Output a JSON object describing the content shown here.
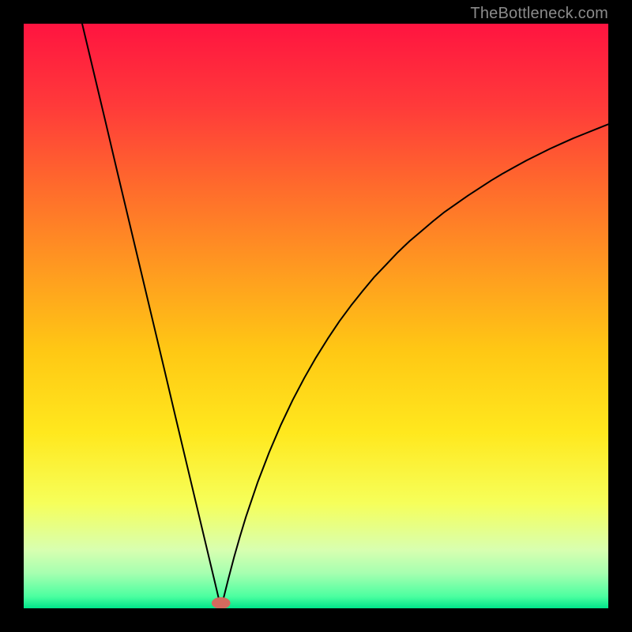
{
  "attribution": "TheBottleneck.com",
  "chart_data": {
    "type": "line",
    "title": "",
    "xlabel": "",
    "ylabel": "",
    "xlim": [
      0,
      100
    ],
    "ylim": [
      0,
      100
    ],
    "background_gradient": {
      "stops": [
        {
          "offset": 0.0,
          "color": "#ff1440"
        },
        {
          "offset": 0.14,
          "color": "#ff3a3a"
        },
        {
          "offset": 0.28,
          "color": "#ff6b2c"
        },
        {
          "offset": 0.42,
          "color": "#ff9a20"
        },
        {
          "offset": 0.56,
          "color": "#ffc814"
        },
        {
          "offset": 0.7,
          "color": "#ffe81e"
        },
        {
          "offset": 0.82,
          "color": "#f6ff5a"
        },
        {
          "offset": 0.9,
          "color": "#d8ffb0"
        },
        {
          "offset": 0.94,
          "color": "#a6ffb0"
        },
        {
          "offset": 0.98,
          "color": "#4bffa0"
        },
        {
          "offset": 1.0,
          "color": "#00e58a"
        }
      ]
    },
    "series": [
      {
        "name": "curve",
        "stroke": "#000000",
        "stroke_width": 2,
        "points": [
          {
            "x": 10.0,
            "y": 100.0
          },
          {
            "x": 12.0,
            "y": 91.6
          },
          {
            "x": 14.0,
            "y": 83.2
          },
          {
            "x": 16.0,
            "y": 74.7
          },
          {
            "x": 18.0,
            "y": 66.3
          },
          {
            "x": 20.0,
            "y": 57.9
          },
          {
            "x": 22.0,
            "y": 49.5
          },
          {
            "x": 24.0,
            "y": 41.1
          },
          {
            "x": 26.0,
            "y": 32.6
          },
          {
            "x": 28.0,
            "y": 24.2
          },
          {
            "x": 30.0,
            "y": 15.8
          },
          {
            "x": 31.0,
            "y": 11.6
          },
          {
            "x": 32.0,
            "y": 7.4
          },
          {
            "x": 32.5,
            "y": 5.3
          },
          {
            "x": 33.0,
            "y": 3.2
          },
          {
            "x": 33.4,
            "y": 1.5
          },
          {
            "x": 33.75,
            "y": 0.0
          },
          {
            "x": 34.1,
            "y": 1.4
          },
          {
            "x": 34.5,
            "y": 3.0
          },
          {
            "x": 35.0,
            "y": 5.0
          },
          {
            "x": 36.0,
            "y": 8.8
          },
          {
            "x": 37.0,
            "y": 12.3
          },
          {
            "x": 38.0,
            "y": 15.6
          },
          {
            "x": 40.0,
            "y": 21.5
          },
          {
            "x": 42.0,
            "y": 26.7
          },
          {
            "x": 44.0,
            "y": 31.4
          },
          {
            "x": 46.0,
            "y": 35.6
          },
          {
            "x": 48.0,
            "y": 39.4
          },
          {
            "x": 50.0,
            "y": 42.9
          },
          {
            "x": 52.0,
            "y": 46.1
          },
          {
            "x": 54.0,
            "y": 49.1
          },
          {
            "x": 56.0,
            "y": 51.8
          },
          {
            "x": 58.0,
            "y": 54.3
          },
          {
            "x": 60.0,
            "y": 56.7
          },
          {
            "x": 62.0,
            "y": 58.8
          },
          {
            "x": 64.0,
            "y": 60.9
          },
          {
            "x": 66.0,
            "y": 62.8
          },
          {
            "x": 68.0,
            "y": 64.5
          },
          {
            "x": 70.0,
            "y": 66.2
          },
          {
            "x": 72.0,
            "y": 67.8
          },
          {
            "x": 74.0,
            "y": 69.2
          },
          {
            "x": 76.0,
            "y": 70.6
          },
          {
            "x": 78.0,
            "y": 71.9
          },
          {
            "x": 80.0,
            "y": 73.2
          },
          {
            "x": 82.0,
            "y": 74.4
          },
          {
            "x": 84.0,
            "y": 75.5
          },
          {
            "x": 86.0,
            "y": 76.6
          },
          {
            "x": 88.0,
            "y": 77.6
          },
          {
            "x": 90.0,
            "y": 78.6
          },
          {
            "x": 92.0,
            "y": 79.5
          },
          {
            "x": 94.0,
            "y": 80.4
          },
          {
            "x": 96.0,
            "y": 81.2
          },
          {
            "x": 98.0,
            "y": 82.0
          },
          {
            "x": 100.0,
            "y": 82.8
          }
        ]
      }
    ],
    "marker": {
      "name": "minimum-marker",
      "x": 33.75,
      "y": 0.9,
      "rx": 1.6,
      "ry": 1.0,
      "fill": "#d36a5e"
    }
  }
}
